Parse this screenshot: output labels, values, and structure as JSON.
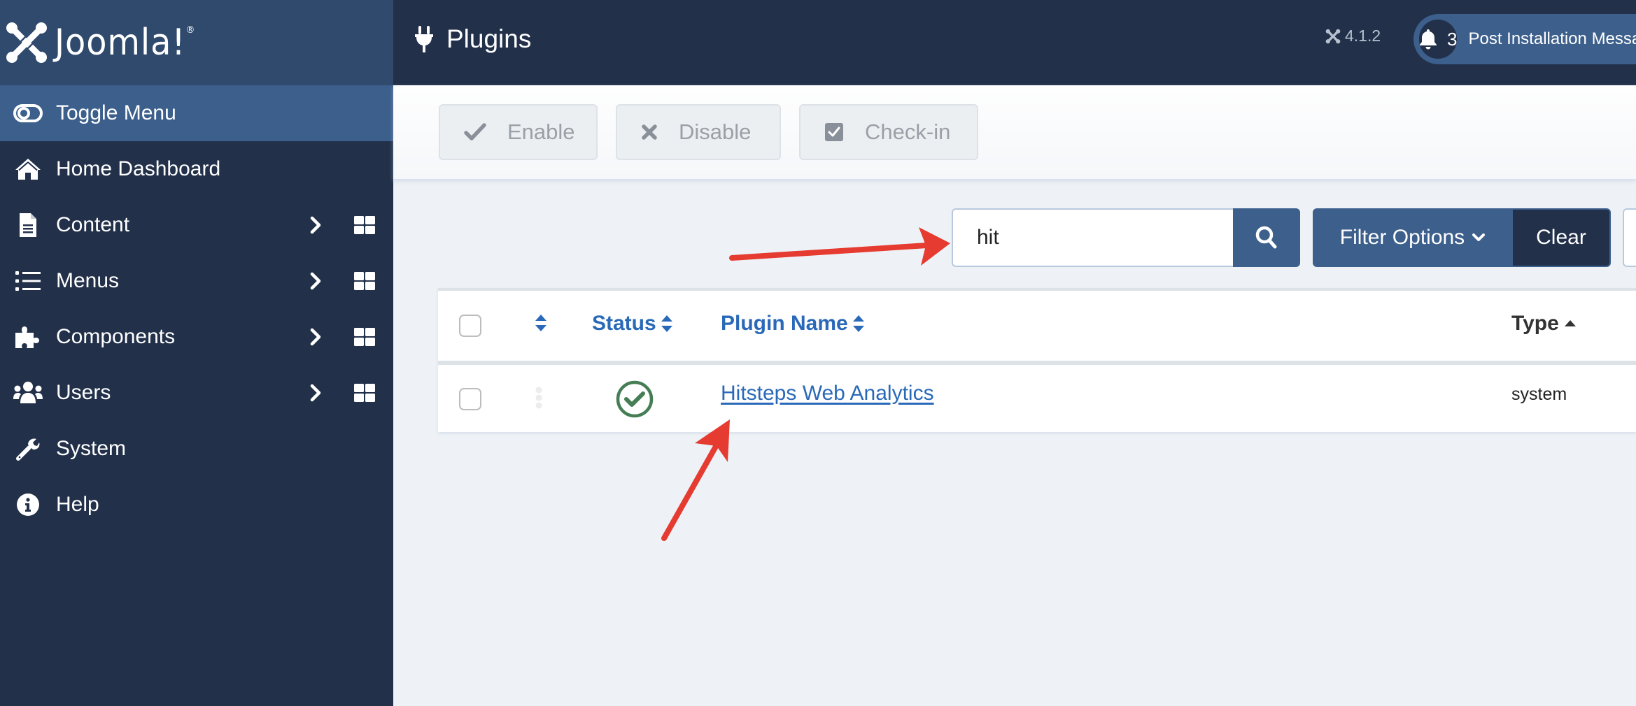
{
  "brand": {
    "name": "Joomla!",
    "trademark": "®"
  },
  "sidebar": {
    "items": [
      {
        "label": "Toggle Menu",
        "icon": "toggle-icon"
      },
      {
        "label": "Home Dashboard",
        "icon": "home-icon"
      },
      {
        "label": "Content",
        "icon": "file-icon",
        "has_submenu": true,
        "has_dashboard": true
      },
      {
        "label": "Menus",
        "icon": "list-icon",
        "has_submenu": true,
        "has_dashboard": true
      },
      {
        "label": "Components",
        "icon": "puzzle-icon",
        "has_submenu": true,
        "has_dashboard": true
      },
      {
        "label": "Users",
        "icon": "users-icon",
        "has_submenu": true,
        "has_dashboard": true
      },
      {
        "label": "System",
        "icon": "wrench-icon"
      },
      {
        "label": "Help",
        "icon": "info-icon"
      }
    ]
  },
  "header": {
    "title": "Plugins",
    "title_icon": "plug-icon",
    "version": "4.1.2",
    "notifications_count": "3",
    "post_install_label": "Post Installation Messages"
  },
  "toolbar": {
    "enable_label": "Enable",
    "disable_label": "Disable",
    "checkin_label": "Check-in"
  },
  "search": {
    "value": "hit",
    "placeholder": "Search",
    "filter_options_label": "Filter Options",
    "clear_label": "Clear"
  },
  "table": {
    "columns": {
      "ordering": "",
      "status": "Status",
      "plugin_name": "Plugin Name",
      "type": "Type"
    },
    "sort": {
      "column": "Type",
      "direction": "ascending"
    },
    "rows": [
      {
        "status": "enabled",
        "plugin_name": "Hitsteps Web Analytics",
        "type": "system"
      }
    ]
  },
  "annotations": {
    "color": "#e53b30",
    "arrows": [
      {
        "points_to": "search-input"
      },
      {
        "points_to": "plugin-name-link"
      }
    ]
  },
  "colors": {
    "sidebar_bg": "#22304a",
    "brand_bg": "#2f4a6d",
    "accent": "#3c5f8c",
    "link": "#2a69b8",
    "status_enabled": "#457d54"
  }
}
